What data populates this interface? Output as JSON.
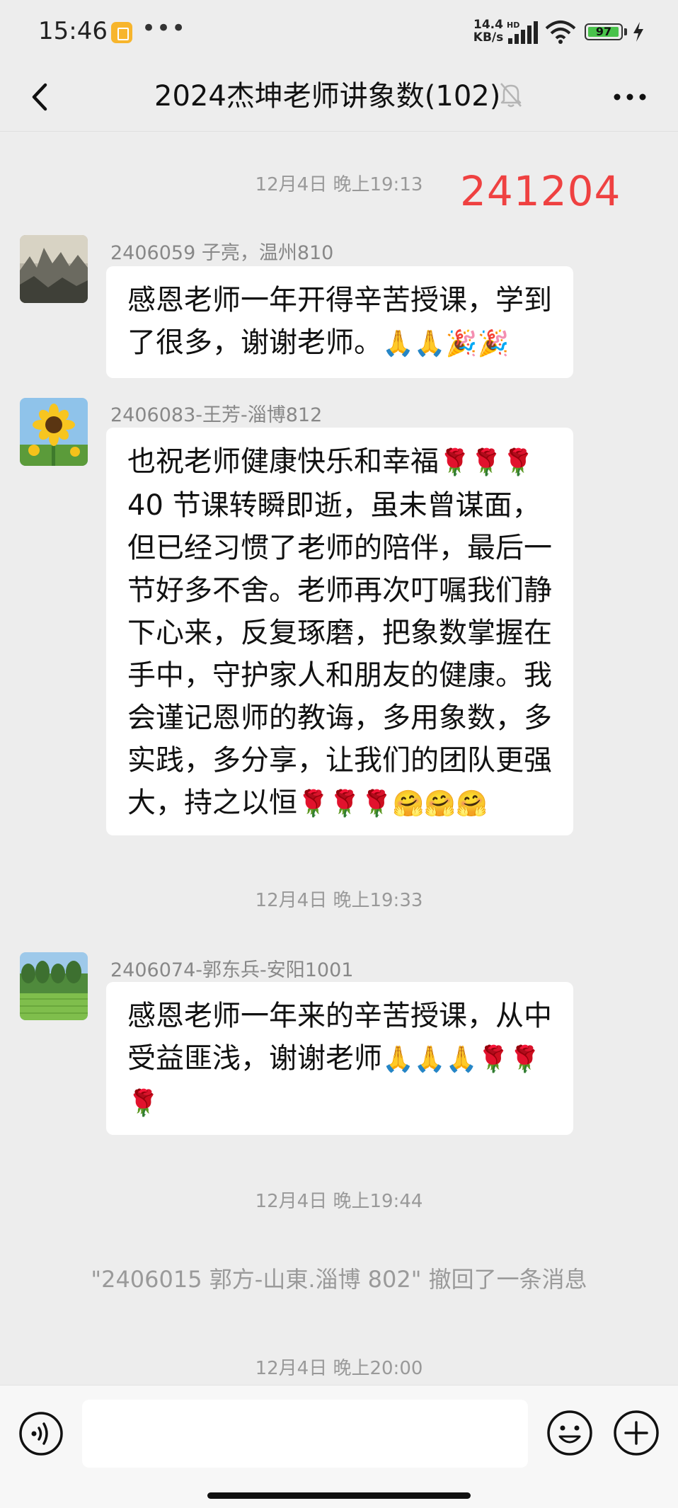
{
  "status_bar": {
    "time": "15:46",
    "dots": "•••",
    "net_speed_value": "14.4",
    "net_speed_unit": "KB/s",
    "signal_label": "HD",
    "battery": "97",
    "battery_level": 0.97,
    "battery_color": "#49c24b"
  },
  "header": {
    "title": "2024杰坤老师讲象数(102)",
    "back_icon": "chevron-left-icon",
    "mute_icon": "bell-muted-icon",
    "more_icon": "more-dots-icon"
  },
  "overlay_stamp": "241204",
  "overlay_color": "#ef4141",
  "messages": [
    {
      "timestamp": "12月4日 晚上19:13",
      "sender": "2406059 子亮，温州810",
      "text": "感恩老师一年开得辛苦授课，学到了很多，谢谢老师。",
      "emojis": "🙏🙏🎉🎉"
    },
    {
      "sender": "2406083-王芳-淄博812",
      "text": "也祝老师健康快乐和幸福",
      "emojis_inline": "🌹🌹🌹",
      "text2": "40 节课转瞬即逝，虽未曾谋面，但已经习惯了老师的陪伴，最后一节好多不舍。老师再次叮嘱我们静下心来，反复琢磨，把象数掌握在手中，守护家人和朋友的健康。我会谨记恩师的教诲，多用象数，多实践，多分享，让我们的团队更强大，持之以恒",
      "emojis": "🌹🌹🌹🤗🤗🤗"
    },
    {
      "timestamp": "12月4日 晚上19:33",
      "sender": "2406074-郭东兵-安阳1001",
      "text": "感恩老师一年来的辛苦授课，从中受益匪浅，谢谢老师",
      "emojis": "🙏🙏🙏🌹🌹🌹"
    }
  ],
  "system": {
    "timestamp": "12月4日 晚上19:44",
    "recall_notice": "\"2406015 郭方-山東.淄博 802\" 撤回了一条消息",
    "last_timestamp": "12月4日 晚上20:00"
  },
  "input_bar": {
    "voice_icon": "voice-icon",
    "input_value": "",
    "emoji_icon": "smiley-icon",
    "plus_icon": "plus-circle-icon"
  }
}
